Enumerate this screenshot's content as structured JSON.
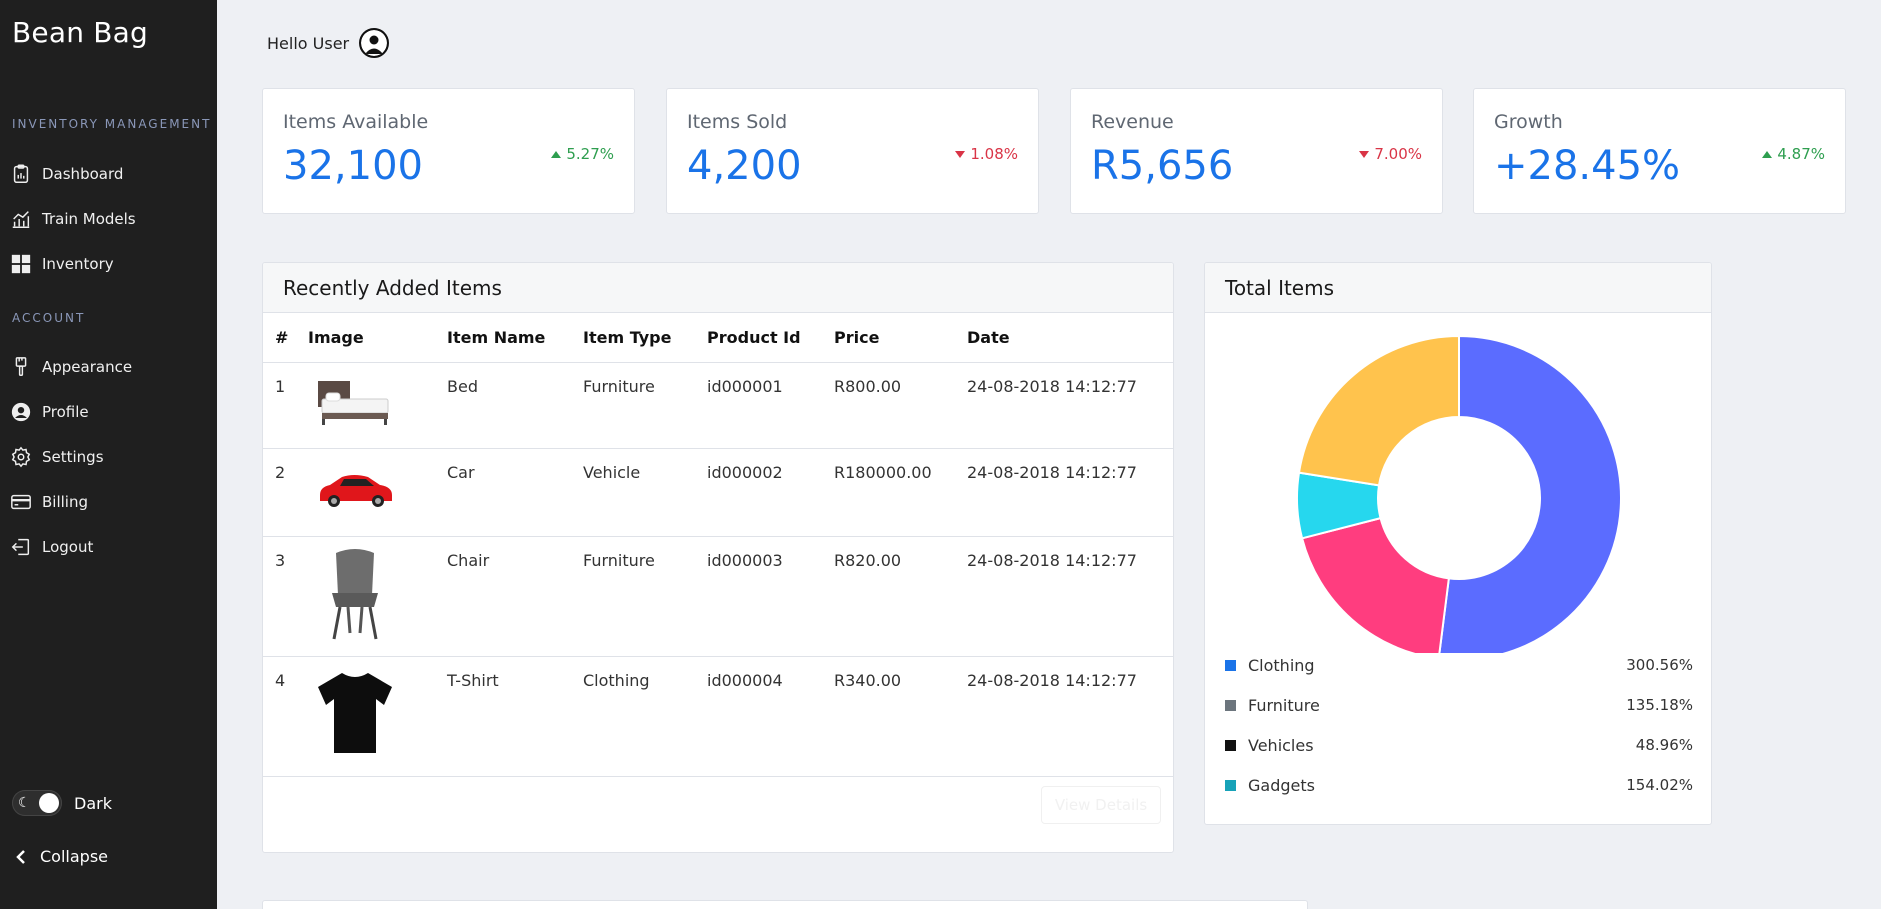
{
  "app": {
    "brand": "Bean Bag"
  },
  "sidebar": {
    "section_inventory": "INVENTORY MANAGEMENT",
    "section_account": "ACCOUNT",
    "items": [
      {
        "label": "Dashboard",
        "icon": "clipboard-icon"
      },
      {
        "label": "Train Models",
        "icon": "chart-icon"
      },
      {
        "label": "Inventory",
        "icon": "grid-icon"
      },
      {
        "label": "Appearance",
        "icon": "brush-icon"
      },
      {
        "label": "Profile",
        "icon": "user-circle-icon"
      },
      {
        "label": "Settings",
        "icon": "gear-icon"
      },
      {
        "label": "Billing",
        "icon": "credit-card-icon"
      },
      {
        "label": "Logout",
        "icon": "logout-icon"
      }
    ],
    "theme_toggle_label": "Dark",
    "collapse_label": "Collapse"
  },
  "header": {
    "greeting": "Hello User"
  },
  "stats": [
    {
      "title": "Items Available",
      "value": "32,100",
      "change": "5.27%",
      "direction": "up"
    },
    {
      "title": "Items Sold",
      "value": "4,200",
      "change": "1.08%",
      "direction": "down"
    },
    {
      "title": "Revenue",
      "value": "R5,656",
      "change": "7.00%",
      "direction": "down"
    },
    {
      "title": "Growth",
      "value": "+28.45%",
      "change": "4.87%",
      "direction": "up"
    }
  ],
  "recent": {
    "title": "Recently Added Items",
    "columns": [
      "#",
      "Image",
      "Item Name",
      "Item Type",
      "Product Id",
      "Price",
      "Date"
    ],
    "rows": [
      {
        "num": "1",
        "image": "bed",
        "name": "Bed",
        "type": "Furniture",
        "id": "id000001",
        "price": "R800.00",
        "date": "24-08-2018 14:12:77"
      },
      {
        "num": "2",
        "image": "car",
        "name": "Car",
        "type": "Vehicle",
        "id": "id000002",
        "price": "R180000.00",
        "date": "24-08-2018 14:12:77"
      },
      {
        "num": "3",
        "image": "chair",
        "name": "Chair",
        "type": "Furniture",
        "id": "id000003",
        "price": "R820.00",
        "date": "24-08-2018 14:12:77"
      },
      {
        "num": "4",
        "image": "tshirt",
        "name": "T-Shirt",
        "type": "Clothing",
        "id": "id000004",
        "price": "R340.00",
        "date": "24-08-2018 14:12:77"
      }
    ],
    "view_details": "View Details"
  },
  "total": {
    "title": "Total Items",
    "legend": [
      {
        "label": "Clothing",
        "pct": "300.56%",
        "color": "#1a73e8"
      },
      {
        "label": "Furniture",
        "pct": "135.18%",
        "color": "#6c757d"
      },
      {
        "label": "Vehicles",
        "pct": "48.96%",
        "color": "#111111"
      },
      {
        "label": "Gadgets",
        "pct": "154.02%",
        "color": "#17a2b8"
      }
    ]
  },
  "chart_data": {
    "type": "pie",
    "title": "",
    "labels": [],
    "values": [
      52,
      19,
      6.5,
      22.5
    ],
    "colors": [
      "#5b6cff",
      "#ff3d7f",
      "#26d7ee",
      "#ffc34d"
    ]
  }
}
